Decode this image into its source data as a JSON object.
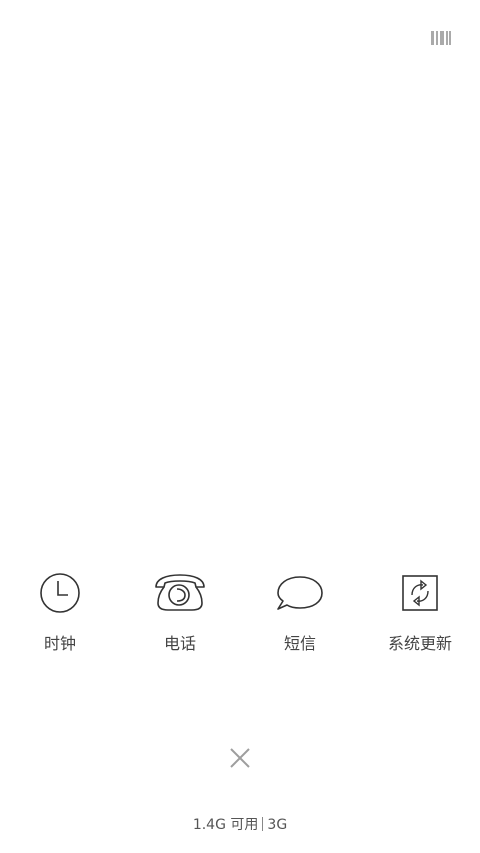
{
  "header": {
    "top_right_icon": "barcode-icon"
  },
  "apps": [
    {
      "label": "时钟",
      "icon": "clock-icon"
    },
    {
      "label": "电话",
      "icon": "phone-icon"
    },
    {
      "label": "短信",
      "icon": "message-icon"
    },
    {
      "label": "系统更新",
      "icon": "system-update-icon"
    }
  ],
  "controls": {
    "close_icon": "close-icon"
  },
  "memory": {
    "available": "1.4G 可用",
    "total": "3G"
  },
  "colors": {
    "background": "#ffffff",
    "icon_stroke": "#333333",
    "close_icon": "#9e9e9e"
  }
}
